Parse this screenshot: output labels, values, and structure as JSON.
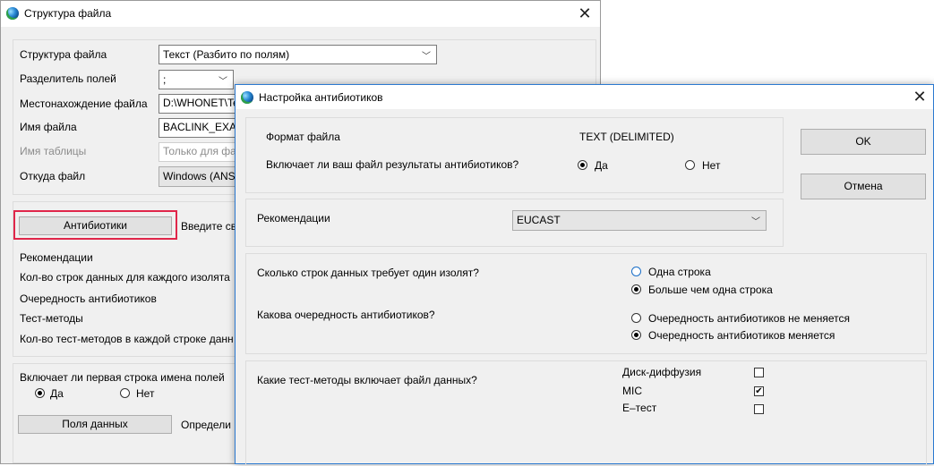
{
  "bg_window": {
    "title": "Структура файла",
    "labels": {
      "structure": "Структура файла",
      "delimiter": "Разделитель полей",
      "location": "Местонахождение файла",
      "filename": "Имя файла",
      "table": "Имя таблицы",
      "source": "Откуда файл",
      "recs": "Рекомендации",
      "rows_per_isolate": "Кол-во строк данных для каждого изолята",
      "ab_order": "Очередность антибиотиков",
      "test_methods": "Тест-методы",
      "methods_per_row": "Кол-во тест-методов в каждой строке данн",
      "first_row": "Включает ли первая строка имена полей",
      "enter_hint": "Введите св",
      "define_hint": "Определи"
    },
    "values": {
      "structure": "Текст (Разбито по полям)",
      "delimiter": ";",
      "location": "D:\\WHONET\\Te",
      "filename": "BACLINK_EXA",
      "table": "Только для фа",
      "source": "Windows (ANS"
    },
    "buttons": {
      "antibiotics": "Антибиотики",
      "data_fields": "Поля данных"
    },
    "first_row_options": {
      "yes": "Да",
      "no": "Нет"
    }
  },
  "dialog": {
    "title": "Настройка антибиотиков",
    "file_format_label": "Формат файла",
    "file_format_value": "TEXT (DELIMITED)",
    "includes_results_q": "Включает ли ваш файл результаты антибиотиков?",
    "yes": "Да",
    "no": "Нет",
    "recommendations_label": "Рекомендации",
    "recommendations_value": "EUCAST",
    "rows_q": "Сколько строк данных требует один изолят?",
    "rows_one": "Одна строка",
    "rows_many": "Больше чем одна строка",
    "order_q": "Какова очередность антибиотиков?",
    "order_fixed": "Очередность антибиотиков не меняется",
    "order_varies": "Очередность антибиотиков меняется",
    "methods_q": "Какие тест-методы включает файл данных?",
    "methods": [
      {
        "label": "Диск-диффузия",
        "checked": false
      },
      {
        "label": "MIC",
        "checked": true
      },
      {
        "label": "E–тест",
        "checked": false
      }
    ],
    "ok": "OK",
    "cancel": "Отмена"
  },
  "colors": {
    "highlight": "#e0264a",
    "radio_blue": "#1a6fc8"
  }
}
